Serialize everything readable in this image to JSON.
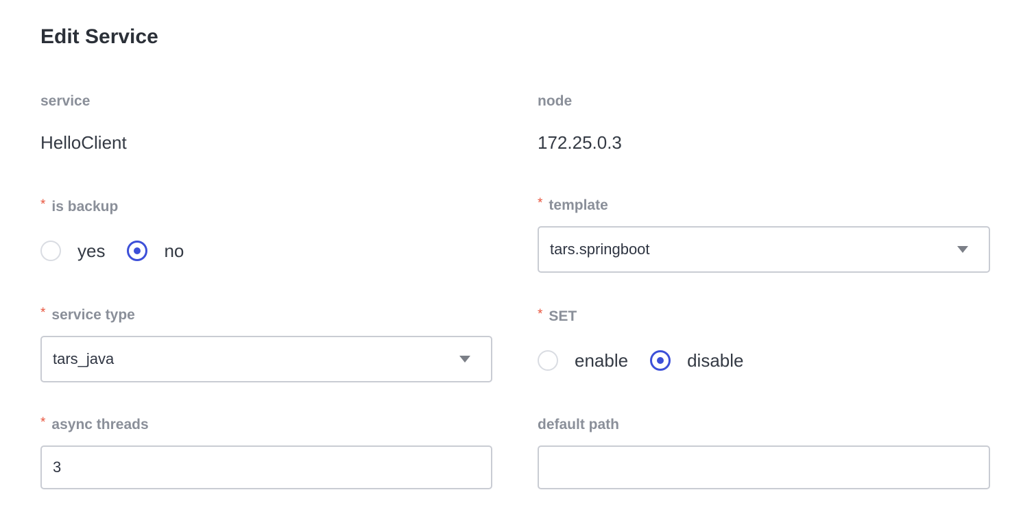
{
  "page": {
    "title": "Edit Service"
  },
  "fields": {
    "service": {
      "label": "service",
      "value": "HelloClient"
    },
    "node": {
      "label": "node",
      "value": "172.25.0.3"
    },
    "is_backup": {
      "required_mark": "*",
      "label": "is backup",
      "options": [
        {
          "label": "yes",
          "checked": false
        },
        {
          "label": "no",
          "checked": true
        }
      ]
    },
    "template": {
      "required_mark": "*",
      "label": "template",
      "selected": "tars.springboot",
      "icon": "caret-down-icon"
    },
    "service_type": {
      "required_mark": "*",
      "label": "service type",
      "selected": "tars_java",
      "icon": "caret-down-icon"
    },
    "set": {
      "required_mark": "*",
      "label": "SET",
      "options": [
        {
          "label": "enable",
          "checked": false
        },
        {
          "label": "disable",
          "checked": true
        }
      ]
    },
    "async_threads": {
      "required_mark": "*",
      "label": "async threads",
      "value": "3"
    },
    "default_path": {
      "label": "default path",
      "value": "",
      "placeholder": ""
    }
  },
  "colors": {
    "accent": "#3c4fd8",
    "required": "#e8553e",
    "label": "#8a8f99",
    "border": "#c9ccd3"
  }
}
